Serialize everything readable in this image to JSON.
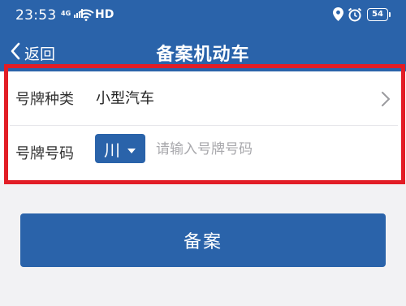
{
  "status_bar": {
    "time": "23:53",
    "signal": "4G",
    "network": "HD",
    "battery": "54",
    "icons": [
      "signal-icon",
      "wifi-icon",
      "location-icon",
      "alarm-icon",
      "battery-icon"
    ]
  },
  "nav": {
    "back_label": "返回",
    "title": "备案机动车",
    "back_icon": "chevron-left-icon"
  },
  "form": {
    "plate_type": {
      "label": "号牌种类",
      "value": "小型汽车",
      "icon": "chevron-right-icon"
    },
    "plate_number": {
      "label": "号牌号码",
      "province": "川",
      "placeholder": "请输入号牌号码",
      "value": ""
    }
  },
  "submit": {
    "label": "备案"
  },
  "colors": {
    "primary": "#2a63aa",
    "highlight": "#e21d26",
    "background": "#f2f2f4"
  }
}
